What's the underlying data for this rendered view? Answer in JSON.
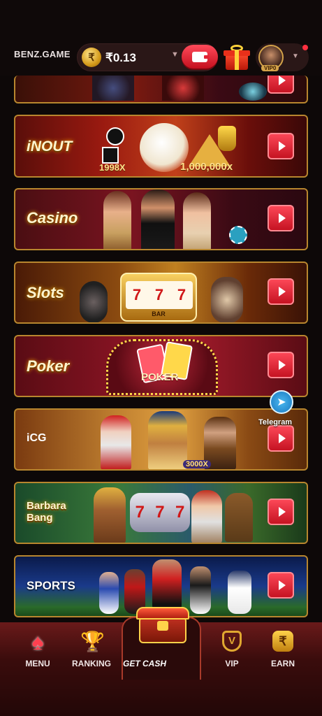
{
  "header": {
    "brand": "BENZ.GAME",
    "currency_symbol": "₹",
    "balance": "₹0.13",
    "vip_level": "VIP0"
  },
  "banners": [
    {
      "id": "top-partial",
      "title": ""
    },
    {
      "id": "inout",
      "title": "iNOUT",
      "multipliers": [
        "1998X",
        "1,000,000x"
      ]
    },
    {
      "id": "casino",
      "title": "Casino"
    },
    {
      "id": "slots",
      "title": "Slots",
      "reels": [
        "7",
        "7",
        "7"
      ],
      "reel_label": "BAR"
    },
    {
      "id": "poker",
      "title": "Poker",
      "sign": "POKER"
    },
    {
      "id": "icg",
      "title": "iCG",
      "multiplier": "3000X"
    },
    {
      "id": "barbara",
      "title": "Barbara Bang",
      "reels": [
        "7",
        "7",
        "7"
      ]
    },
    {
      "id": "sports",
      "title": "SPORTS"
    }
  ],
  "telegram": {
    "label": "Telegram"
  },
  "footer": {
    "items": [
      {
        "label": "MENU"
      },
      {
        "label": "RANKING"
      },
      {
        "label": "GET CASH"
      },
      {
        "label": "VIP"
      },
      {
        "label": "EARN"
      }
    ]
  },
  "colors": {
    "accent_red": "#e22232",
    "gold_border": "#b8862e",
    "background": "#0d0808"
  }
}
